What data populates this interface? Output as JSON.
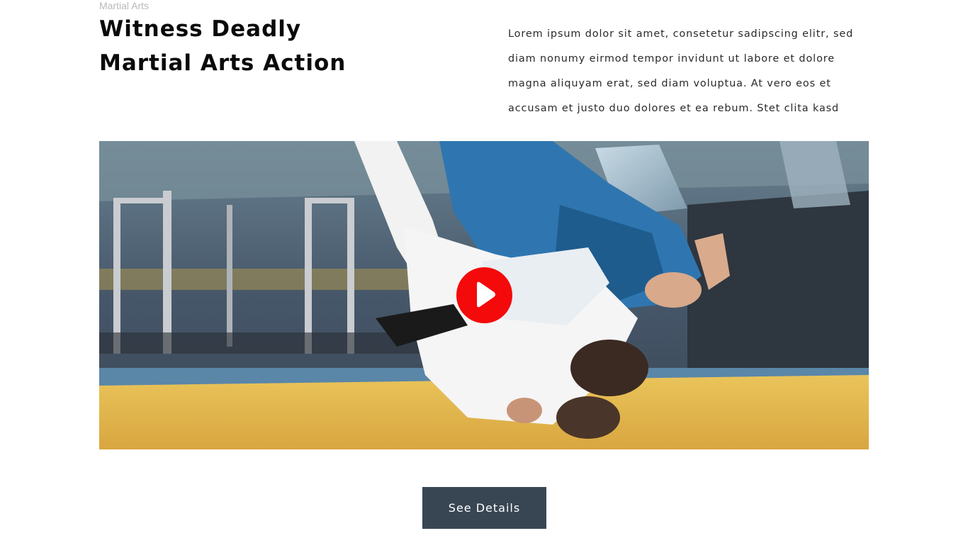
{
  "section": {
    "eyebrow": "Martial Arts",
    "headline_line1": "Witness Deadly",
    "headline_line2": "Martial Arts Action",
    "intro": "Lorem ipsum dolor sit amet, consetetur sadipscing elitr, sed diam nonumy eirmod tempor invidunt ut labore et dolore magna aliquyam erat, sed diam voluptua. At vero eos et accusam et justo duo dolores et ea rebum. Stet clita kasd"
  },
  "video": {
    "play_icon": "play-icon",
    "play_color": "#f40a0a"
  },
  "cta": {
    "label": "See Details",
    "color": "#384654"
  }
}
